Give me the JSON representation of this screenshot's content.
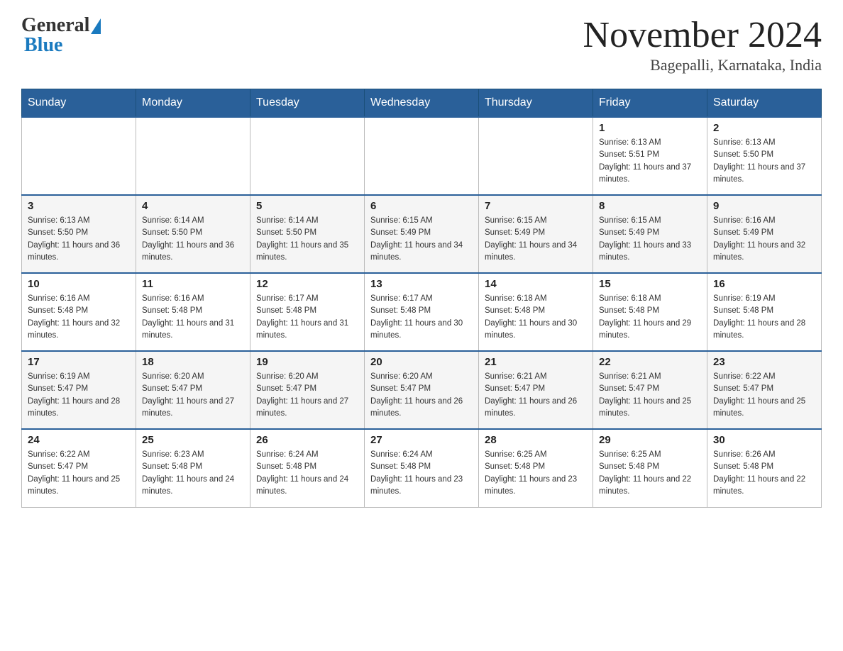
{
  "header": {
    "logo": {
      "general": "General",
      "blue": "Blue"
    },
    "title": "November 2024",
    "subtitle": "Bagepalli, Karnataka, India"
  },
  "days_of_week": [
    "Sunday",
    "Monday",
    "Tuesday",
    "Wednesday",
    "Thursday",
    "Friday",
    "Saturday"
  ],
  "weeks": [
    [
      {
        "day": "",
        "info": ""
      },
      {
        "day": "",
        "info": ""
      },
      {
        "day": "",
        "info": ""
      },
      {
        "day": "",
        "info": ""
      },
      {
        "day": "",
        "info": ""
      },
      {
        "day": "1",
        "info": "Sunrise: 6:13 AM\nSunset: 5:51 PM\nDaylight: 11 hours and 37 minutes."
      },
      {
        "day": "2",
        "info": "Sunrise: 6:13 AM\nSunset: 5:50 PM\nDaylight: 11 hours and 37 minutes."
      }
    ],
    [
      {
        "day": "3",
        "info": "Sunrise: 6:13 AM\nSunset: 5:50 PM\nDaylight: 11 hours and 36 minutes."
      },
      {
        "day": "4",
        "info": "Sunrise: 6:14 AM\nSunset: 5:50 PM\nDaylight: 11 hours and 36 minutes."
      },
      {
        "day": "5",
        "info": "Sunrise: 6:14 AM\nSunset: 5:50 PM\nDaylight: 11 hours and 35 minutes."
      },
      {
        "day": "6",
        "info": "Sunrise: 6:15 AM\nSunset: 5:49 PM\nDaylight: 11 hours and 34 minutes."
      },
      {
        "day": "7",
        "info": "Sunrise: 6:15 AM\nSunset: 5:49 PM\nDaylight: 11 hours and 34 minutes."
      },
      {
        "day": "8",
        "info": "Sunrise: 6:15 AM\nSunset: 5:49 PM\nDaylight: 11 hours and 33 minutes."
      },
      {
        "day": "9",
        "info": "Sunrise: 6:16 AM\nSunset: 5:49 PM\nDaylight: 11 hours and 32 minutes."
      }
    ],
    [
      {
        "day": "10",
        "info": "Sunrise: 6:16 AM\nSunset: 5:48 PM\nDaylight: 11 hours and 32 minutes."
      },
      {
        "day": "11",
        "info": "Sunrise: 6:16 AM\nSunset: 5:48 PM\nDaylight: 11 hours and 31 minutes."
      },
      {
        "day": "12",
        "info": "Sunrise: 6:17 AM\nSunset: 5:48 PM\nDaylight: 11 hours and 31 minutes."
      },
      {
        "day": "13",
        "info": "Sunrise: 6:17 AM\nSunset: 5:48 PM\nDaylight: 11 hours and 30 minutes."
      },
      {
        "day": "14",
        "info": "Sunrise: 6:18 AM\nSunset: 5:48 PM\nDaylight: 11 hours and 30 minutes."
      },
      {
        "day": "15",
        "info": "Sunrise: 6:18 AM\nSunset: 5:48 PM\nDaylight: 11 hours and 29 minutes."
      },
      {
        "day": "16",
        "info": "Sunrise: 6:19 AM\nSunset: 5:48 PM\nDaylight: 11 hours and 28 minutes."
      }
    ],
    [
      {
        "day": "17",
        "info": "Sunrise: 6:19 AM\nSunset: 5:47 PM\nDaylight: 11 hours and 28 minutes."
      },
      {
        "day": "18",
        "info": "Sunrise: 6:20 AM\nSunset: 5:47 PM\nDaylight: 11 hours and 27 minutes."
      },
      {
        "day": "19",
        "info": "Sunrise: 6:20 AM\nSunset: 5:47 PM\nDaylight: 11 hours and 27 minutes."
      },
      {
        "day": "20",
        "info": "Sunrise: 6:20 AM\nSunset: 5:47 PM\nDaylight: 11 hours and 26 minutes."
      },
      {
        "day": "21",
        "info": "Sunrise: 6:21 AM\nSunset: 5:47 PM\nDaylight: 11 hours and 26 minutes."
      },
      {
        "day": "22",
        "info": "Sunrise: 6:21 AM\nSunset: 5:47 PM\nDaylight: 11 hours and 25 minutes."
      },
      {
        "day": "23",
        "info": "Sunrise: 6:22 AM\nSunset: 5:47 PM\nDaylight: 11 hours and 25 minutes."
      }
    ],
    [
      {
        "day": "24",
        "info": "Sunrise: 6:22 AM\nSunset: 5:47 PM\nDaylight: 11 hours and 25 minutes."
      },
      {
        "day": "25",
        "info": "Sunrise: 6:23 AM\nSunset: 5:48 PM\nDaylight: 11 hours and 24 minutes."
      },
      {
        "day": "26",
        "info": "Sunrise: 6:24 AM\nSunset: 5:48 PM\nDaylight: 11 hours and 24 minutes."
      },
      {
        "day": "27",
        "info": "Sunrise: 6:24 AM\nSunset: 5:48 PM\nDaylight: 11 hours and 23 minutes."
      },
      {
        "day": "28",
        "info": "Sunrise: 6:25 AM\nSunset: 5:48 PM\nDaylight: 11 hours and 23 minutes."
      },
      {
        "day": "29",
        "info": "Sunrise: 6:25 AM\nSunset: 5:48 PM\nDaylight: 11 hours and 22 minutes."
      },
      {
        "day": "30",
        "info": "Sunrise: 6:26 AM\nSunset: 5:48 PM\nDaylight: 11 hours and 22 minutes."
      }
    ]
  ]
}
